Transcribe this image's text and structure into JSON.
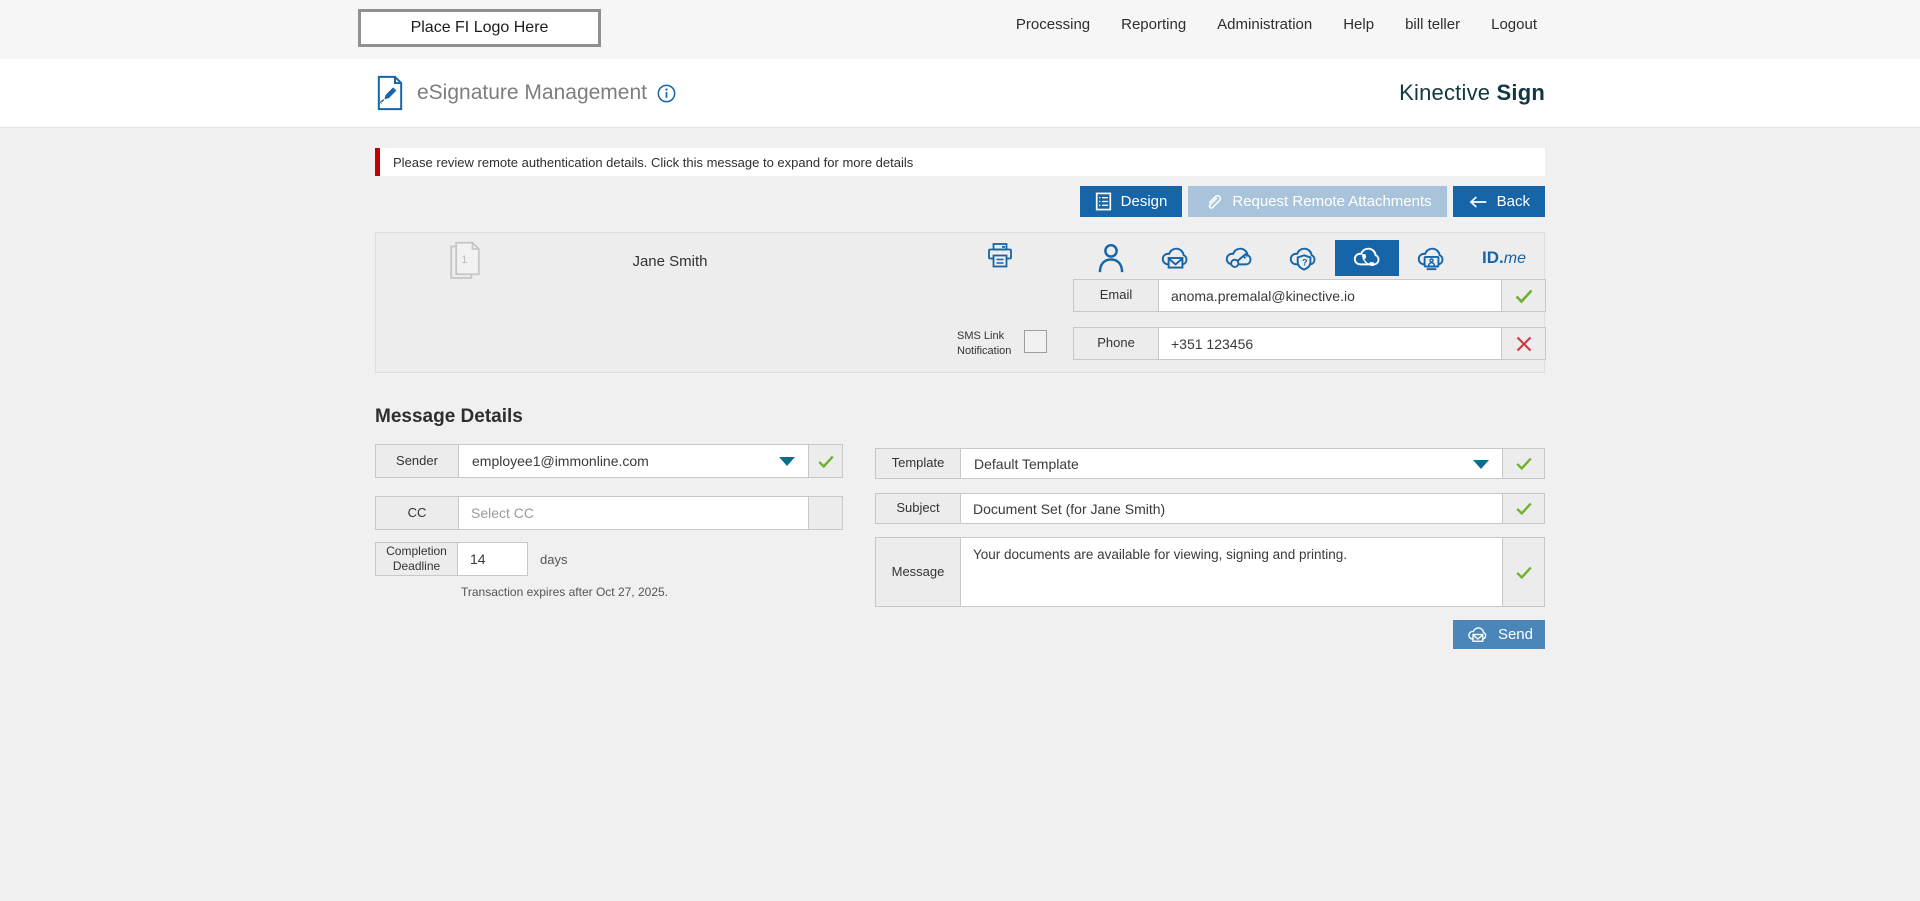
{
  "topbar": {
    "logo_text": "Place FI Logo Here",
    "nav": [
      "Processing",
      "Reporting",
      "Administration",
      "Help",
      "bill teller",
      "Logout"
    ]
  },
  "header": {
    "title": "eSignature Management",
    "brand": "Kinective",
    "brand_bold": "Sign"
  },
  "alert": {
    "text": "Please review remote authentication details. Click this message to expand for more details"
  },
  "actions": {
    "design": "Design",
    "request_remote_attachments": "Request Remote Attachments",
    "back": "Back"
  },
  "recipient": {
    "name": "Jane Smith",
    "document_count": "1",
    "email": {
      "label": "Email",
      "value": "anoma.premalal@kinective.io"
    },
    "sms": {
      "line1": "SMS Link",
      "line2": "Notification"
    },
    "phone": {
      "label": "Phone",
      "value": "+351 123456"
    },
    "idme": {
      "bold": "ID.",
      "italic": "me"
    }
  },
  "message_details": {
    "heading": "Message Details",
    "sender": {
      "label": "Sender",
      "value": "employee1@immonline.com"
    },
    "cc": {
      "label": "CC",
      "placeholder": "Select CC"
    },
    "deadline": {
      "label_line1": "Completion",
      "label_line2": "Deadline",
      "value": "14",
      "unit": "days"
    },
    "expiry_note": "Transaction expires after Oct 27, 2025.",
    "template": {
      "label": "Template",
      "value": "Default Template"
    },
    "subject": {
      "label": "Subject",
      "value": "Document Set (for Jane Smith)"
    },
    "message": {
      "label": "Message",
      "value": "Your documents are available for viewing, signing and printing."
    },
    "send_label": "Send"
  },
  "colors": {
    "accent_blue": "#1565a8",
    "disabled_button": "#a9c4da",
    "send_button": "#4a86ba",
    "valid_green": "#6fb02c",
    "invalid_red": "#cf3a47",
    "alert_red": "#c40000",
    "dropdown_teal": "#0e6c8d",
    "brand_teal": "#12383f"
  }
}
